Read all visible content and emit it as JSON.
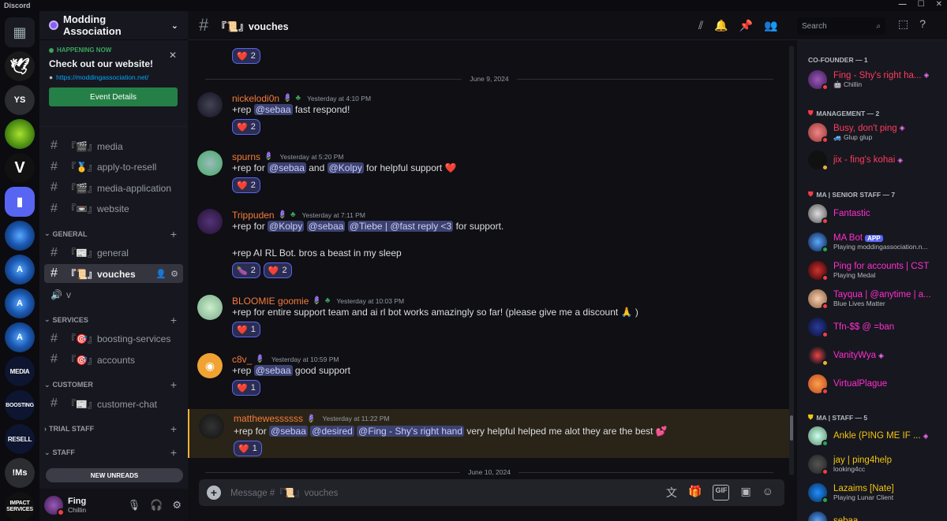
{
  "app": {
    "title": "Discord"
  },
  "colors": {
    "accent": "#5865f2",
    "online": "#23a55a",
    "dnd": "#f23f43",
    "cofounder": "#e91e63",
    "staff": "#f1c40f",
    "senior": "#ff2fd0"
  },
  "servers": [
    "YS",
    "!Ms",
    "MEDIA",
    "BOOSTING",
    "RESELL",
    "IMPACT SERVICES"
  ],
  "guild": {
    "name": "Modding Association"
  },
  "event": {
    "status": "HAPPENING NOW",
    "title": "Check out our website!",
    "url": "https://moddingassociation.net/",
    "button": "Event Details"
  },
  "channels": {
    "top": [
      {
        "name": "『🎬』media"
      },
      {
        "name": "『🥇』apply-to-resell"
      },
      {
        "name": "『🎬』media-application"
      },
      {
        "name": "『📼』website"
      }
    ],
    "categories": [
      {
        "name": "GENERAL"
      },
      {
        "name": "SERVICES"
      },
      {
        "name": "CUSTOMER"
      },
      {
        "name": "TRIAL STAFF"
      },
      {
        "name": "STAFF"
      }
    ],
    "general": [
      {
        "name": "『📰』general"
      },
      {
        "name": "『📜』vouches"
      },
      {
        "name": "v"
      }
    ],
    "services": [
      {
        "name": "『🎯』boosting-services"
      },
      {
        "name": "『🎯』accounts"
      }
    ],
    "customer": [
      {
        "name": "『📰』customer-chat"
      }
    ]
  },
  "new_unreads": "NEW UNREADS",
  "user": {
    "name": "Fing",
    "status": "Chillin"
  },
  "header": {
    "channel": "『📜』vouches",
    "search_placeholder": "Search"
  },
  "dates": [
    "June 9, 2024",
    "June 10, 2024"
  ],
  "messages": [
    {
      "author": "nickelodi0n",
      "time": "Yesterday at 4:10 PM",
      "pre": "+rep ",
      "mentions": [
        "@sebaa"
      ],
      "post": " fast respond!",
      "reactions": [
        {
          "emoji": "❤️",
          "count": "2"
        }
      ]
    },
    {
      "author": "spurns",
      "time": "Yesterday at 5:20 PM",
      "pre": "+rep for ",
      "m1": "@sebaa",
      "mid": " and ",
      "m2": "@Kolpy",
      "post": " for helpful support ❤️",
      "reactions": [
        {
          "emoji": "❤️",
          "count": "2"
        }
      ]
    },
    {
      "author": "Trippuden",
      "time": "Yesterday at 7:11 PM",
      "pre": "+rep for ",
      "m1": "@Kolpy",
      "m2": "@sebaa",
      "m3": "@Tiebe | @fast reply <3",
      "post": " for support.",
      "line2": "+rep AI RL Bot. bros a beast in my sleep",
      "reactions": [
        {
          "emoji": "🍆",
          "count": "2"
        },
        {
          "emoji": "❤️",
          "count": "2"
        }
      ]
    },
    {
      "author": "BLOOMIE goomie",
      "time": "Yesterday at 10:03 PM",
      "text": "+rep for entire support team and ai rl bot works amazingly so far! (please give me a discount 🙏 )",
      "reactions": [
        {
          "emoji": "❤️",
          "count": "1"
        }
      ]
    },
    {
      "author": "c8v_",
      "time": "Yesterday at 10:59 PM",
      "pre": "+rep ",
      "m1": "@sebaa",
      "post": " good support",
      "reactions": [
        {
          "emoji": "❤️",
          "count": "1"
        }
      ]
    },
    {
      "author": "matthewessssss",
      "time": "Yesterday at 11:22 PM",
      "pre": "+rep for ",
      "m1": "@sebaa",
      "m2": "@desired",
      "m3": "@Fing - Shy's right hand",
      "post": " very helpful helped me alot they are the best 💕",
      "reactions": [
        {
          "emoji": "❤️",
          "count": "1"
        }
      ]
    }
  ],
  "top_partial_reaction": {
    "emoji": "❤️",
    "count": "2"
  },
  "composer": {
    "placeholder": "Message #『📜』vouches"
  },
  "members": {
    "cat_cofounder": "CO-FOUNDER — 1",
    "cat_management": "MANAGEMENT — 2",
    "cat_senior": "MA | SENIOR STAFF — 7",
    "cat_staff": "MA | STAFF — 5",
    "list": [
      {
        "name": "Fing - Shy's right ha...",
        "sub": "🤖 Chillin"
      },
      {
        "name": "Busy, don't ping",
        "sub": "🚙 Glup glup"
      },
      {
        "name": "jix - fing's kohai",
        "sub": ""
      },
      {
        "name": "Fantastic",
        "sub": ""
      },
      {
        "name": "MA Bot",
        "badge": "APP",
        "sub": "Playing moddingassociation.n..."
      },
      {
        "name": "Ping for accounts | CST",
        "sub": "Playing Medal"
      },
      {
        "name": "Tayqua | @anytime | a...",
        "sub": "Blue Lives Matter"
      },
      {
        "name": "Tfn-$$ @ =ban",
        "sub": ""
      },
      {
        "name": "VanityWya",
        "sub": ""
      },
      {
        "name": "VirtualPlague",
        "sub": ""
      },
      {
        "name": "Ankle (PING ME IF ...",
        "sub": ""
      },
      {
        "name": "jay | ping4help",
        "sub": "looking4cc"
      },
      {
        "name": "Lazaims [Nate]",
        "sub": "Playing Lunar Client"
      },
      {
        "name": "sebaa",
        "sub": ""
      }
    ]
  }
}
